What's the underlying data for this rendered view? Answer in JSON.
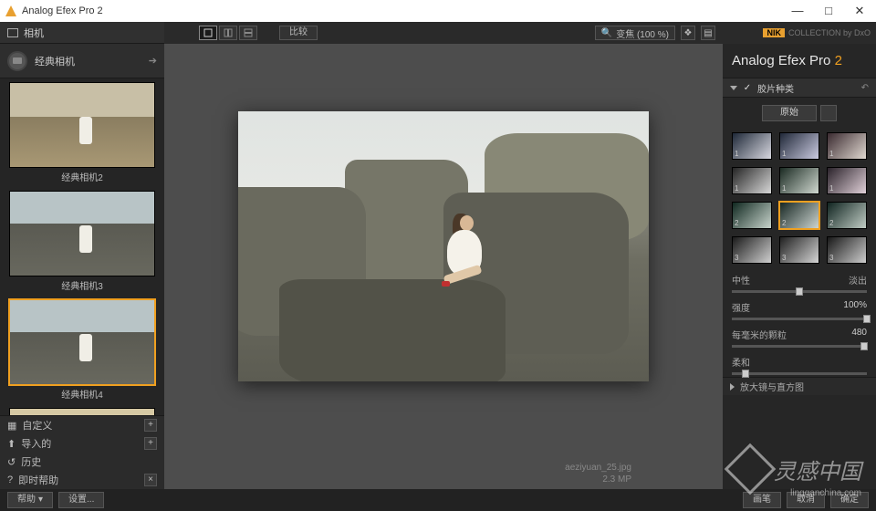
{
  "titlebar": {
    "app_name": "Analog Efex Pro 2"
  },
  "window_controls": {
    "min": "—",
    "max": "□",
    "close": "✕"
  },
  "left": {
    "camera_header": "相机",
    "preset_group": "经典相机",
    "thumbs": [
      {
        "label": "经典相机2"
      },
      {
        "label": "经典相机3"
      },
      {
        "label": "经典相机4",
        "selected": true
      }
    ],
    "sections": {
      "custom": "自定义",
      "imported": "导入的",
      "history": "历史",
      "instant_help": "即时帮助"
    }
  },
  "center_toolbar": {
    "compare": "比较",
    "zoom_icon": "🔍",
    "zoom_label": "变焦 (100 %)"
  },
  "image": {
    "filename": "aeziyuan_25.jpg",
    "megapixels": "2.3 MP"
  },
  "right": {
    "brand_chip": "NIK",
    "brand_suffix": "COLLECTION by DxO",
    "product": "Analog Efex Pro",
    "version": "2",
    "section_title": "胶片种类",
    "type_button": "原始",
    "swatch_rows": [
      [
        "1",
        "1",
        "1"
      ],
      [
        "1",
        "1",
        "1"
      ],
      [
        "2",
        "2",
        "2"
      ],
      [
        "3",
        "3",
        "3"
      ]
    ],
    "selected_swatch": 7,
    "slider1": {
      "left": "中性",
      "right": "淡出",
      "pos": 50
    },
    "slider2": {
      "label": "强度",
      "value": "100%",
      "pos": 100
    },
    "slider3": {
      "label": "每毫米的颗粒",
      "value": "480",
      "pos": 98
    },
    "slider4": {
      "label": "柔和",
      "value": "",
      "pos": 10
    },
    "collapsed_section": "放大镜与直方图"
  },
  "bottom": {
    "help": "帮助",
    "settings": "设置...",
    "brush": "画笔",
    "cancel": "取消",
    "ok": "确定"
  },
  "watermark": {
    "text": "灵感中国",
    "sub": "lingganchina.com"
  }
}
